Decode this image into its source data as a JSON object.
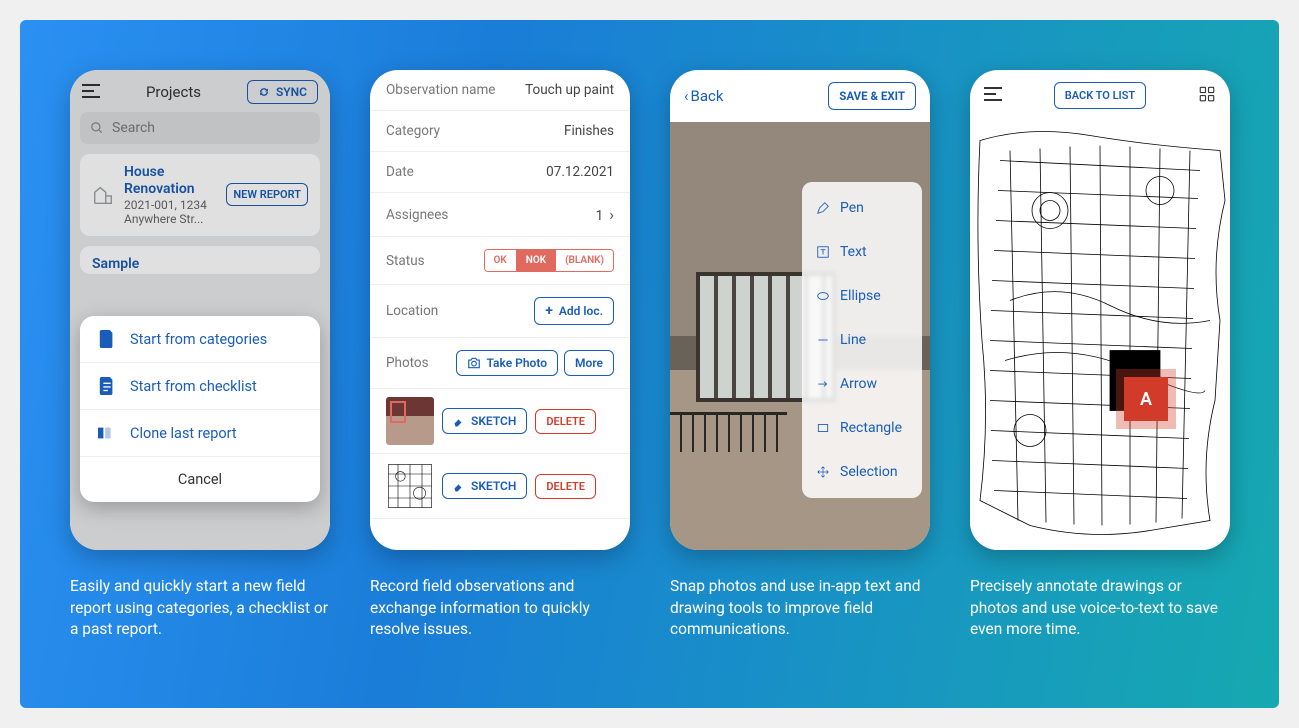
{
  "captions": [
    "Easily and quickly start a new field report using categories, a checklist or a past report.",
    "Record field observations and exchange information to quickly resolve issues.",
    "Snap photos and use in-app text and drawing tools to improve field communications.",
    "Precisely annotate drawings or photos and use voice-to-text to save even more time."
  ],
  "phone1": {
    "title": "Projects",
    "sync": "SYNC",
    "search_placeholder": "Search",
    "card": {
      "title": "House Renovation",
      "sub": "2021-001, 1234 Anywhere Str...",
      "button": "NEW REPORT"
    },
    "sample": "Sample",
    "sheet": {
      "items": [
        "Start from categories",
        "Start from checklist",
        "Clone last report"
      ],
      "cancel": "Cancel"
    }
  },
  "phone2": {
    "rows": {
      "obs_label": "Observation name",
      "obs_value": "Touch up paint",
      "cat_label": "Category",
      "cat_value": "Finishes",
      "date_label": "Date",
      "date_value": "07.12.2021",
      "assign_label": "Assignees",
      "assign_value": "1",
      "status_label": "Status",
      "status_ok": "OK",
      "status_nok": "NOK",
      "status_blank": "(BLANK)",
      "loc_label": "Location",
      "loc_btn": "Add loc.",
      "photos_label": "Photos",
      "take_photo": "Take Photo",
      "more": "More",
      "sketch": "SKETCH",
      "delete": "DELETE"
    }
  },
  "phone3": {
    "back": "Back",
    "save": "SAVE & EXIT",
    "tools": [
      "Pen",
      "Text",
      "Ellipse",
      "Line",
      "Arrow",
      "Rectangle",
      "Selection"
    ]
  },
  "phone4": {
    "back_list": "BACK TO LIST",
    "marker": "A"
  }
}
